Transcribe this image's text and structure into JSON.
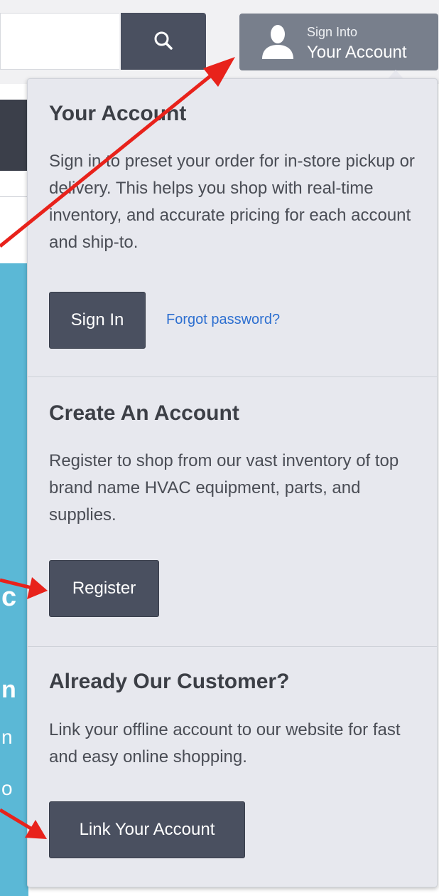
{
  "search": {
    "value": "",
    "button_icon": "search-icon"
  },
  "account_button": {
    "icon": "user-icon",
    "line1": "Sign Into",
    "line2": "Your Account"
  },
  "dropdown": {
    "your_account": {
      "heading": "Your Account",
      "description": "Sign in to preset your order for in-store pickup or delivery. This helps you shop with real-time inventory, and accurate pricing for each account and ship-to.",
      "sign_in_label": "Sign In",
      "forgot_label": "Forgot password?"
    },
    "create_account": {
      "heading": "Create An Account",
      "description": "Register to shop from our vast inventory of top brand name HVAC equipment, parts, and supplies.",
      "register_label": "Register"
    },
    "existing_customer": {
      "heading": "Already Our Customer?",
      "description": "Link your offline account to our website for fast and easy online shopping.",
      "link_label": "Link Your Account"
    }
  },
  "colors": {
    "button_dark": "#4a5060",
    "account_button": "#787f8c",
    "panel_bg": "#e7e8ee",
    "link": "#2d6fd0",
    "annotation_arrow": "#e8221b"
  }
}
